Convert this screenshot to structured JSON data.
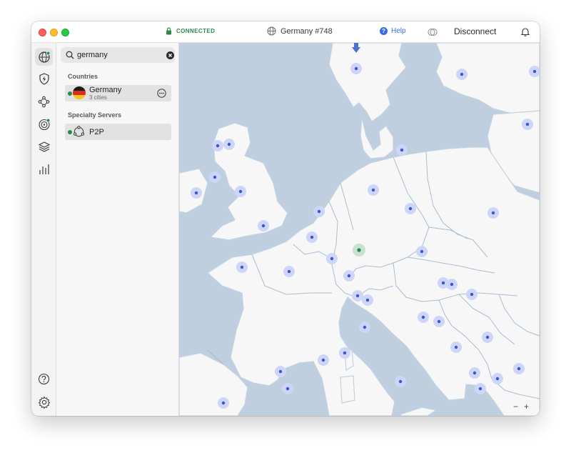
{
  "titlebar": {
    "connection_status": "CONNECTED",
    "server_name": "Germany #748",
    "help_label": "Help",
    "disconnect_label": "Disconnect"
  },
  "search": {
    "value": "germany",
    "placeholder": "Search"
  },
  "results": {
    "countries_heading": "Countries",
    "country": {
      "name": "Germany",
      "subtitle": "3 cities"
    },
    "specialty_heading": "Specialty Servers",
    "specialty": {
      "name": "P2P"
    }
  },
  "map": {
    "zoom_out_label": "−",
    "zoom_in_label": "+"
  },
  "colors": {
    "connected": "#2f8a4a",
    "accent": "#3b6be0",
    "water": "#bfcfdf",
    "land": "#f7f7f7",
    "marker": "#4a5dde"
  },
  "icons": {
    "nav": [
      "globe-icon",
      "shield-bolt-icon",
      "meshnet-icon",
      "target-icon",
      "layers-icon",
      "stats-icon"
    ],
    "bottom": [
      "help-icon",
      "settings-icon"
    ]
  }
}
